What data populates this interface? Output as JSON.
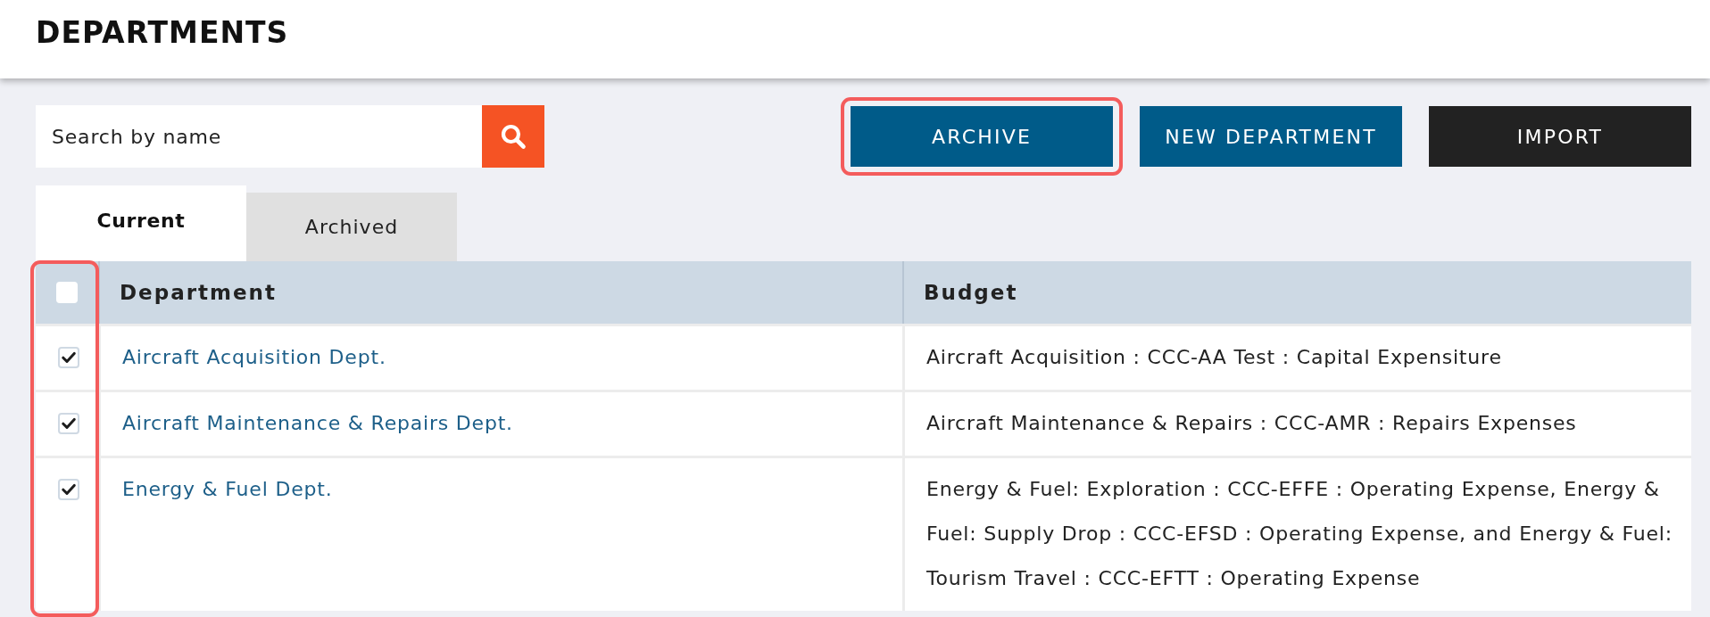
{
  "page": {
    "title": "DEPARTMENTS"
  },
  "search": {
    "placeholder": "Search by name"
  },
  "actions": [
    {
      "label": "ARCHIVE",
      "kind": "primary",
      "highlighted": true
    },
    {
      "label": "NEW DEPARTMENT",
      "kind": "primary",
      "highlighted": false
    },
    {
      "label": "IMPORT",
      "kind": "dark",
      "highlighted": false
    }
  ],
  "tabs": [
    {
      "label": "Current",
      "selected": true
    },
    {
      "label": "Archived",
      "selected": false
    }
  ],
  "table": {
    "select_all": {
      "checked": false
    },
    "checkbox_column_highlighted": true,
    "columns": [
      "Department",
      "Budget"
    ],
    "rows": [
      {
        "checked": true,
        "department": "Aircraft Acquisition Dept.",
        "budget": "Aircraft Acquisition : CCC-AA Test : Capital Expensiture"
      },
      {
        "checked": true,
        "department": "Aircraft Maintenance & Repairs Dept.",
        "budget": "Aircraft Maintenance & Repairs : CCC-AMR : Repairs Expenses"
      },
      {
        "checked": true,
        "department": "Energy & Fuel Dept.",
        "budget": "Energy & Fuel: Exploration : CCC-EFFE : Operating Expense, Energy & Fuel: Supply Drop : CCC-EFSD : Operating Expense, and Energy & Fuel: Tourism Travel : CCC-EFTT : Operating Expense"
      }
    ]
  }
}
